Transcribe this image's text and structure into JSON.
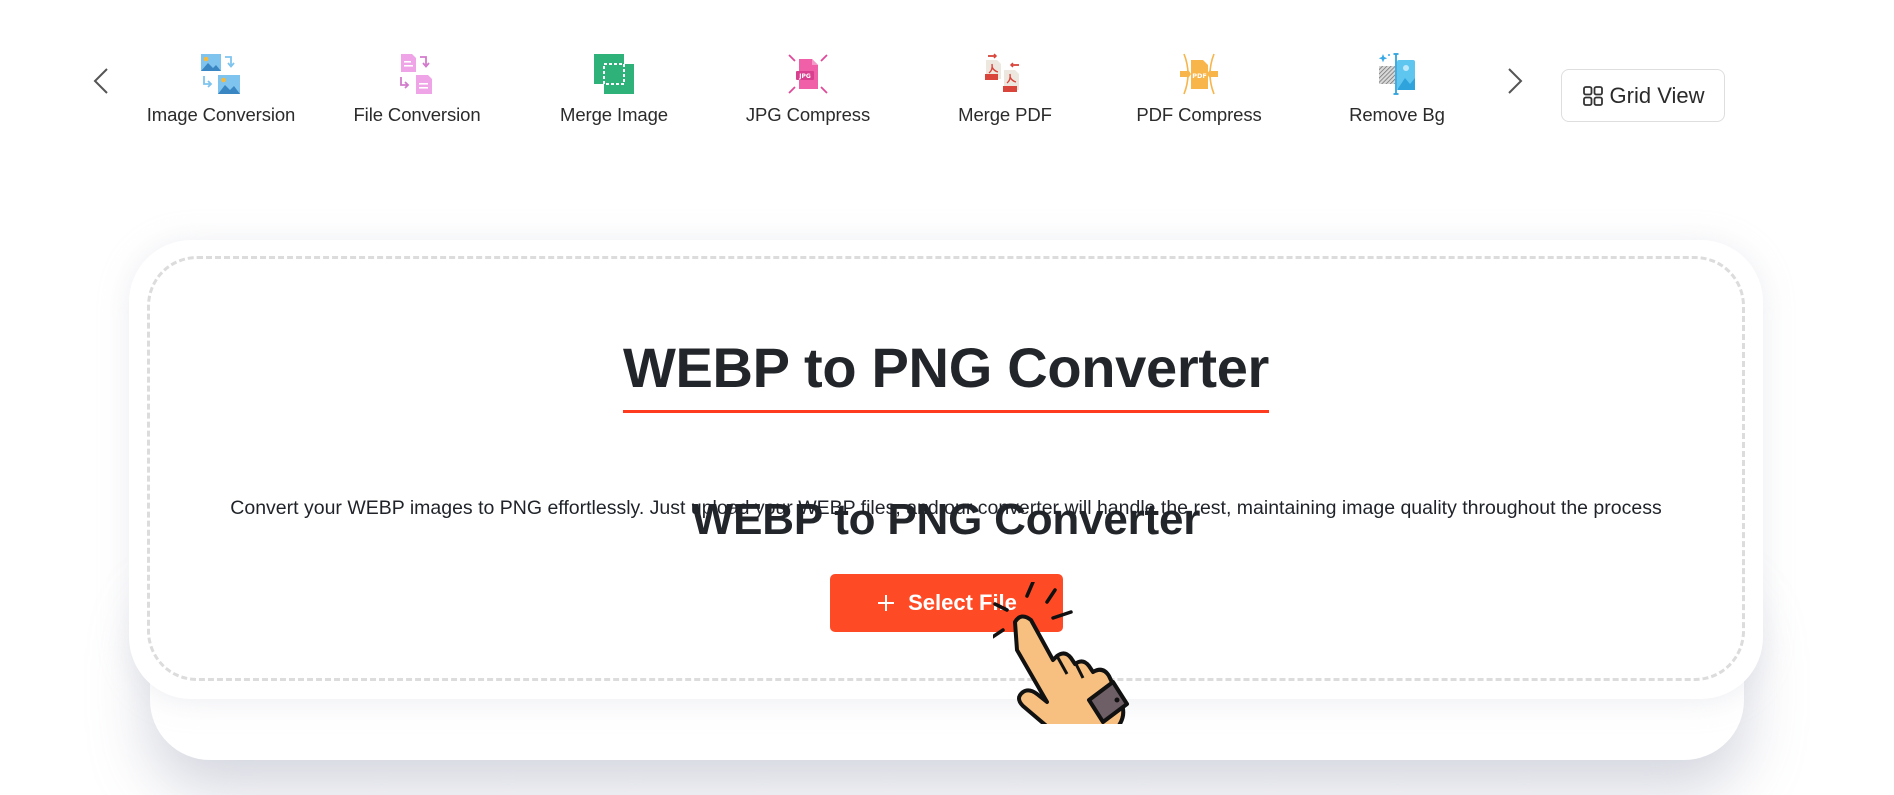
{
  "nav": {
    "prev_label": "Previous",
    "next_label": "Next",
    "items": [
      {
        "label": "Image Conversion",
        "icon": "image-conversion-icon"
      },
      {
        "label": "File Conversion",
        "icon": "file-conversion-icon"
      },
      {
        "label": "Merge Image",
        "icon": "merge-image-icon"
      },
      {
        "label": "JPG Compress",
        "icon": "jpg-compress-icon"
      },
      {
        "label": "Merge PDF",
        "icon": "merge-pdf-icon"
      },
      {
        "label": "PDF Compress",
        "icon": "pdf-compress-icon"
      },
      {
        "label": "Remove Bg",
        "icon": "remove-bg-icon"
      }
    ],
    "grid_view_label": "Grid View"
  },
  "upload": {
    "title": "WEBP to PNG Converter",
    "subtitle": "WEBP to PNG Converter",
    "description": "Convert your WEBP images to PNG  effortlessly. Just upload your WEBP files, and our converter will handle the rest, maintaining image quality throughout the process",
    "select_button_label": "Select File"
  },
  "colors": {
    "accent": "#ff4a26",
    "underline": "#ff3b1f",
    "title_text": "#22252a",
    "dashed_border": "#dcdcdc"
  }
}
